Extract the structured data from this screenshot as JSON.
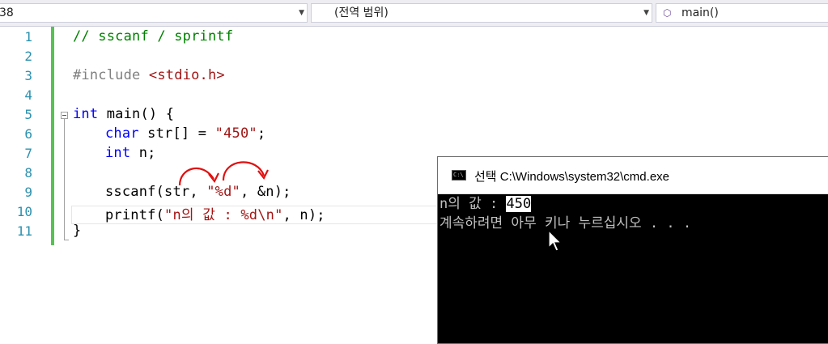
{
  "navbar": {
    "project_combo": "38",
    "scope_combo": "(전역 범위)",
    "function_combo": "main()",
    "function_icon": "cube-icon"
  },
  "editor": {
    "line_numbers": [
      "1",
      "2",
      "3",
      "4",
      "5",
      "6",
      "7",
      "8",
      "9",
      "10",
      "11"
    ],
    "lines": {
      "l1": "// sscanf / sprintf",
      "l3_pp": "#include ",
      "l3_hdr": "<stdio.h>",
      "l5_kw": "int",
      "l5_rest": " main() {",
      "l6_kw": "char",
      "l6_mid": " str[] = ",
      "l6_str": "\"450\"",
      "l6_end": ";",
      "l7_kw": "int",
      "l7_rest": " n;",
      "l9_a": "sscanf(str, ",
      "l9_str": "\"%d\"",
      "l9_b": ", &n);",
      "l10_a": "printf(",
      "l10_str": "\"n의 값 : %d\\n\"",
      "l10_b": ", n);",
      "l11": "}"
    },
    "annotation_color": "#e01010"
  },
  "console": {
    "icon_label": "C:\\",
    "title": "선택 C:\\Windows\\system32\\cmd.exe",
    "line1_prefix": "n의 값 : ",
    "line1_selected": "450",
    "line2": "계속하려면 아무 키나 누르십시오 . . ."
  },
  "colors": {
    "comment": "#008000",
    "keyword": "#0000ff",
    "string": "#a31515",
    "preprocessor": "#808080",
    "line_number": "#2b91af",
    "change_bar": "#57c253"
  }
}
